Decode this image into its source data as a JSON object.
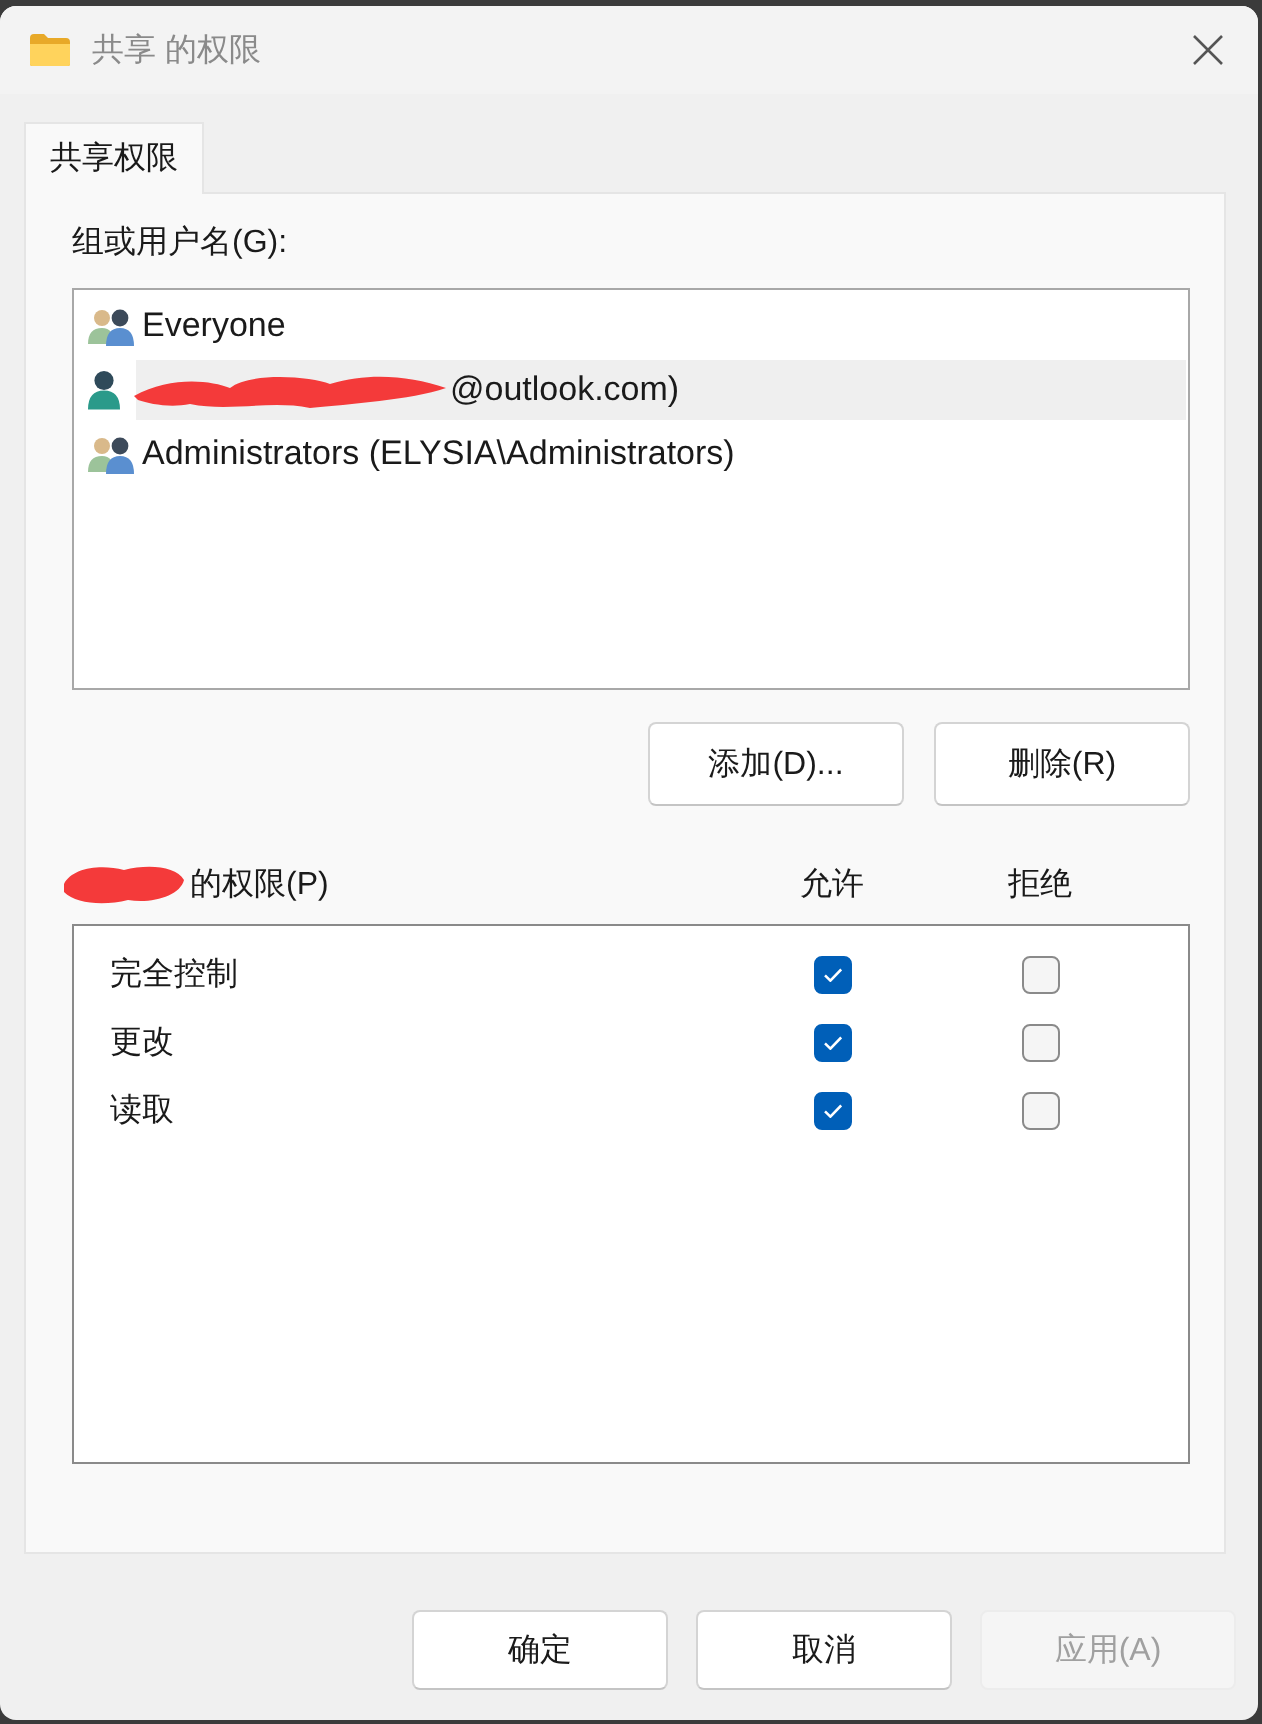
{
  "window": {
    "title": "共享 的权限"
  },
  "tabs": [
    {
      "label": "共享权限",
      "selected": true
    }
  ],
  "group_label": "组或用户名(G):",
  "users": [
    {
      "name": "Everyone",
      "kind": "group",
      "selected": false,
      "redacted": false
    },
    {
      "name": "@outlook.com)",
      "kind": "user",
      "selected": true,
      "redacted": true
    },
    {
      "name": "Administrators (ELYSIA\\Administrators)",
      "kind": "group",
      "selected": false,
      "redacted": false
    }
  ],
  "user_buttons": [
    {
      "label": "添加(D)..."
    },
    {
      "label": "删除(R)"
    }
  ],
  "permissions": {
    "heading": "的权限(P)",
    "heading_redacted": true,
    "columns": [
      "允许",
      "拒绝"
    ],
    "rows": [
      {
        "name": "完全控制",
        "allow": true,
        "deny": false
      },
      {
        "name": "更改",
        "allow": true,
        "deny": false
      },
      {
        "name": "读取",
        "allow": true,
        "deny": false
      }
    ]
  },
  "buttons": [
    {
      "label": "确定",
      "disabled": false
    },
    {
      "label": "取消",
      "disabled": false
    },
    {
      "label": "应用(A)",
      "disabled": true
    }
  ]
}
